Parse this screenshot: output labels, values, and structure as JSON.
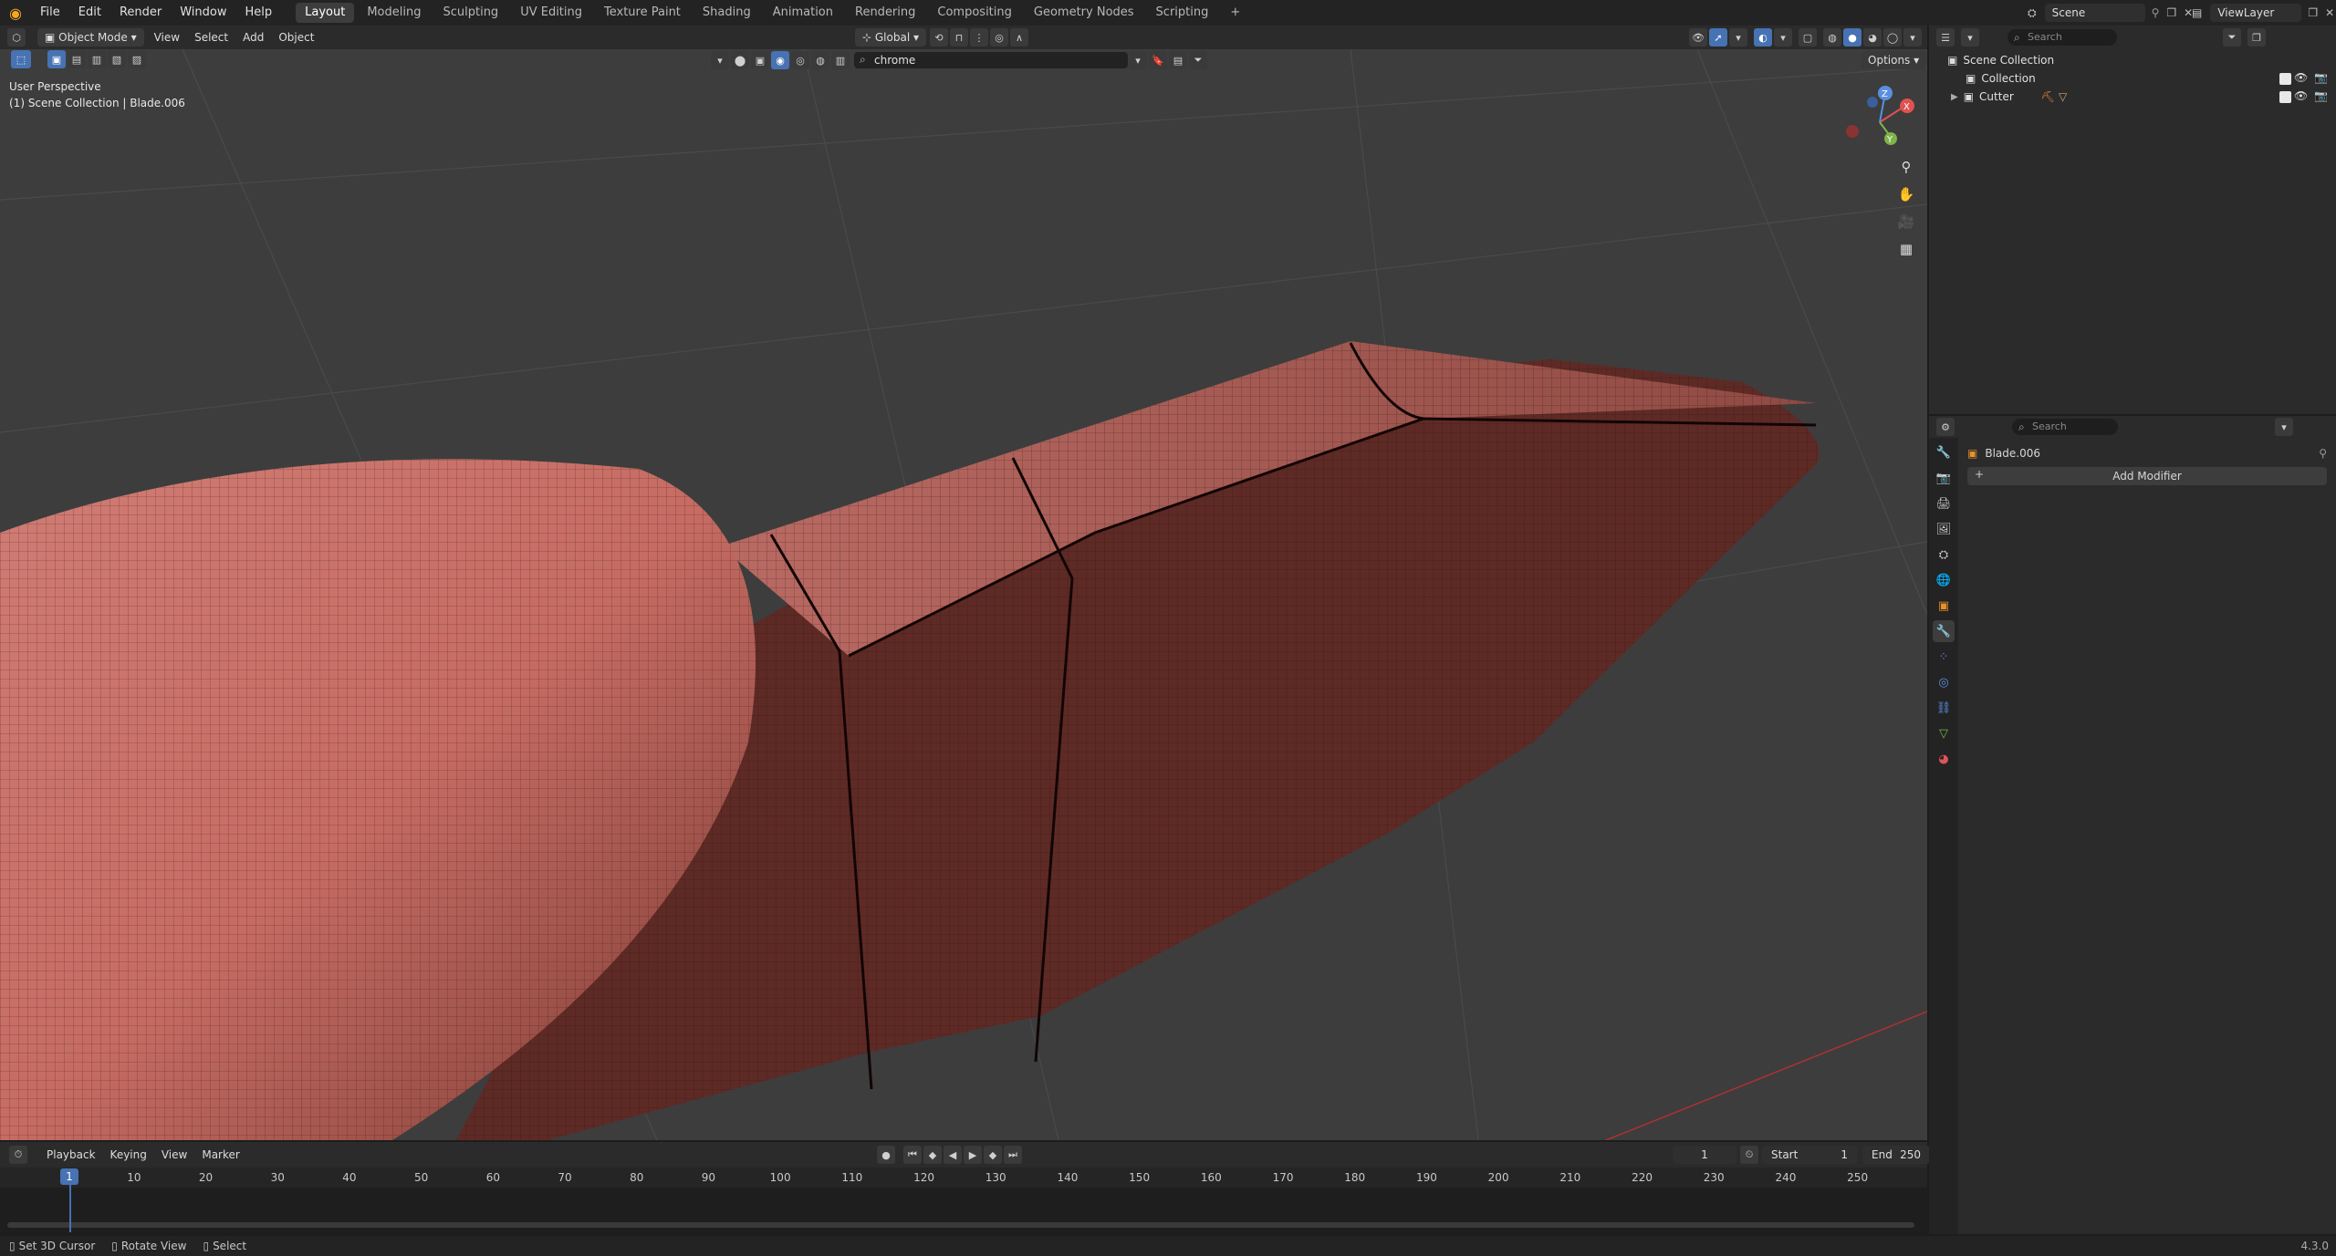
{
  "menu": [
    "File",
    "Edit",
    "Render",
    "Window",
    "Help"
  ],
  "workspaces": [
    "Layout",
    "Modeling",
    "Sculpting",
    "UV Editing",
    "Texture Paint",
    "Shading",
    "Animation",
    "Rendering",
    "Compositing",
    "Geometry Nodes",
    "Scripting"
  ],
  "workspace_add": "+",
  "scene": {
    "label": "Scene",
    "viewlayer": "ViewLayer"
  },
  "viewport": {
    "mode": "Object Mode",
    "menus": [
      "View",
      "Select",
      "Add",
      "Object"
    ],
    "orientation": "Global",
    "search_value": "chrome",
    "options_label": "Options",
    "overlay_line1": "User Perspective",
    "overlay_line2": "(1) Scene Collection | Blade.006",
    "gizmo": {
      "x": "X",
      "y": "Y",
      "z": "Z"
    }
  },
  "outliner": {
    "search_placeholder": "Search",
    "items": [
      {
        "label": "Scene Collection"
      },
      {
        "label": "Collection"
      },
      {
        "label": "Cutter"
      }
    ]
  },
  "properties": {
    "search_placeholder": "Search",
    "object_name": "Blade.006",
    "add_modifier_label": "Add Modifier"
  },
  "timeline": {
    "menus": [
      "Playback",
      "Keying",
      "View",
      "Marker"
    ],
    "current_frame": "1",
    "start_label": "Start",
    "start_value": "1",
    "end_label": "End",
    "end_value": "250",
    "playhead": 1,
    "ticks": [
      "10",
      "20",
      "30",
      "40",
      "50",
      "60",
      "70",
      "80",
      "90",
      "100",
      "110",
      "120",
      "130",
      "140",
      "150",
      "160",
      "170",
      "180",
      "190",
      "200",
      "210",
      "220",
      "230",
      "240",
      "250"
    ]
  },
  "status": {
    "items": [
      "Set 3D Cursor",
      "Rotate View",
      "Select"
    ],
    "version": "4.3.0"
  },
  "colors": {
    "accent": "#4772b3",
    "mesh_light": "#c9726b",
    "mesh_dark": "#5a2a24",
    "viewport_bg": "#3d3d3d",
    "playhead": "#4772b3"
  }
}
